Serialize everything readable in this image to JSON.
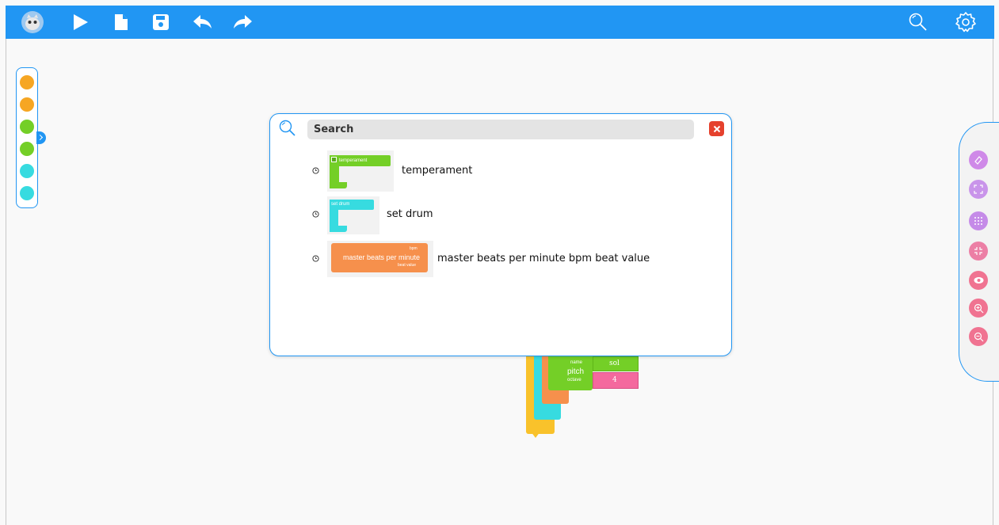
{
  "toolbar": {
    "buttons": [
      {
        "name": "mascot-logo-icon"
      },
      {
        "name": "play-icon"
      },
      {
        "name": "new-file-icon"
      },
      {
        "name": "save-icon"
      },
      {
        "name": "undo-icon"
      },
      {
        "name": "redo-icon"
      },
      {
        "name": "search-icon"
      },
      {
        "name": "settings-icon"
      }
    ],
    "color": "#2196f3"
  },
  "palette": {
    "colors": [
      "#f6a623",
      "#f6a623",
      "#74cf27",
      "#74cf27",
      "#37dbe0",
      "#37dbe0"
    ]
  },
  "side_panel": {
    "buttons": [
      {
        "name": "eraser-icon",
        "color": "#cf89e8"
      },
      {
        "name": "expand-icon",
        "color": "#c994ea"
      },
      {
        "name": "grid-icon",
        "color": "#c58be8"
      },
      {
        "name": "collapse-icon",
        "color": "#ec7fa5"
      },
      {
        "name": "eye-icon",
        "color": "#f07391"
      },
      {
        "name": "zoom-in-icon",
        "color": "#f07391"
      },
      {
        "name": "zoom-out-icon",
        "color": "#f07391"
      }
    ]
  },
  "search": {
    "placeholder": "Search",
    "results": [
      {
        "label": "temperament",
        "block_text": "temperament",
        "color": "#74cf27"
      },
      {
        "label": "set drum",
        "block_text": "set drum",
        "color": "#37dbe0"
      },
      {
        "label": "master beats per minute bpm beat value",
        "block_text": "master beats per minute",
        "arg1": "bpm",
        "arg2": "beat value",
        "color": "#f6904c"
      }
    ]
  },
  "canvas_blocks": {
    "pitch_label": "pitch",
    "name_label": "name",
    "octave_label": "octave",
    "note_value": "sol",
    "octave_value": "4"
  }
}
